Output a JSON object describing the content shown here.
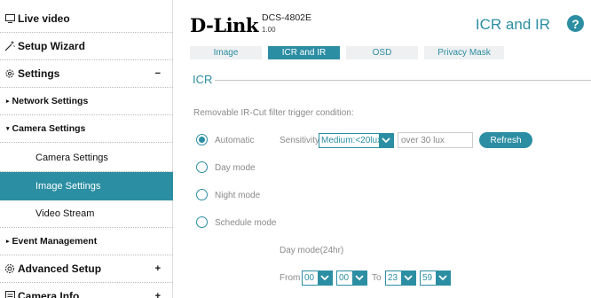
{
  "sidebar": {
    "items": [
      {
        "label": "Live video",
        "icon": "monitor-icon"
      },
      {
        "label": "Setup Wizard",
        "icon": "wand-icon"
      },
      {
        "label": "Settings",
        "icon": "gear-icon",
        "toggle": "−"
      },
      {
        "label": "Network Settings"
      },
      {
        "label": "Camera Settings"
      },
      {
        "label": "Camera Settings"
      },
      {
        "label": "Image Settings"
      },
      {
        "label": "Video Stream"
      },
      {
        "label": "Event Management"
      },
      {
        "label": "Advanced Setup",
        "icon": "gear-advanced-icon",
        "toggle": "+"
      },
      {
        "label": "Camera Info",
        "icon": "info-list-icon",
        "toggle": "+"
      }
    ]
  },
  "header": {
    "brand": "D-Link",
    "model": "DCS-4802E",
    "firmware": "1.00",
    "title": "ICR and IR",
    "help": "?"
  },
  "tabs": [
    "Image",
    "ICR and IR",
    "OSD",
    "Privacy Mask"
  ],
  "icr": {
    "heading": "ICR",
    "condition_label": "Removable IR-Cut filter trigger condition:",
    "modes": [
      "Automatic",
      "Day mode",
      "Night mode",
      "Schedule mode"
    ],
    "sensitivity_label": "Sensitivity",
    "sensitivity_value": "Medium:<20lux",
    "lux_value": "over 30 lux",
    "refresh_label": "Refresh",
    "schedule_heading": "Day mode(24hr)",
    "from_label": "From",
    "to_label": "To",
    "from_hour": "00",
    "from_min": "00",
    "to_hour": "23",
    "to_min": "59"
  },
  "colors": {
    "accent": "#2c8ea3"
  }
}
